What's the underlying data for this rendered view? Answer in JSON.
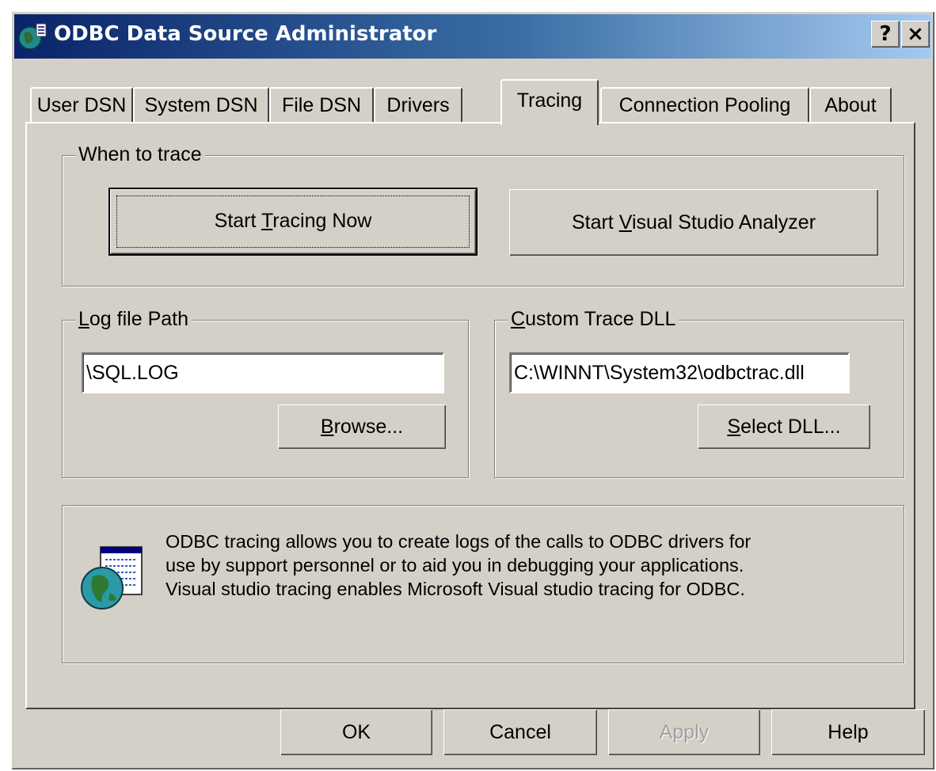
{
  "window": {
    "title": "ODBC Data Source Administrator",
    "help_button": "?",
    "close_button": "×"
  },
  "tabs": [
    {
      "label": "User DSN",
      "active": false
    },
    {
      "label": "System DSN",
      "active": false
    },
    {
      "label": "File DSN",
      "active": false
    },
    {
      "label": "Drivers",
      "active": false
    },
    {
      "label": "Tracing",
      "active": true
    },
    {
      "label": "Connection Pooling",
      "active": false
    },
    {
      "label": "About",
      "active": false
    }
  ],
  "when_to_trace": {
    "label": "When to trace",
    "start_tracing": {
      "pre": "Start ",
      "key": "T",
      "post": "racing Now"
    },
    "start_vs_analyzer": {
      "pre": "Start ",
      "key": "V",
      "post": "isual Studio Analyzer"
    }
  },
  "log_file": {
    "label_key": "L",
    "label_rest": "og file Path",
    "value": "\\SQL.LOG",
    "browse": {
      "key": "B",
      "post": "rowse..."
    }
  },
  "custom_dll": {
    "label_key": "C",
    "label_rest": "ustom Trace DLL",
    "value": "C:\\WINNT\\System32\\odbctrac.dll",
    "select": {
      "key": "S",
      "post": "elect DLL..."
    }
  },
  "info": {
    "icon": "globe-document-icon",
    "lines": [
      "ODBC tracing allows you to create logs of the calls to ODBC drivers for",
      "use by support personnel or to aid you in debugging your applications.",
      "Visual studio tracing enables Microsoft Visual studio tracing for ODBC."
    ]
  },
  "footer": {
    "ok": "OK",
    "cancel": "Cancel",
    "apply": "Apply",
    "help": "Help"
  },
  "colors": {
    "face": "#d4d0c8",
    "title_start": "#0a246a",
    "title_end": "#a6caf0"
  }
}
